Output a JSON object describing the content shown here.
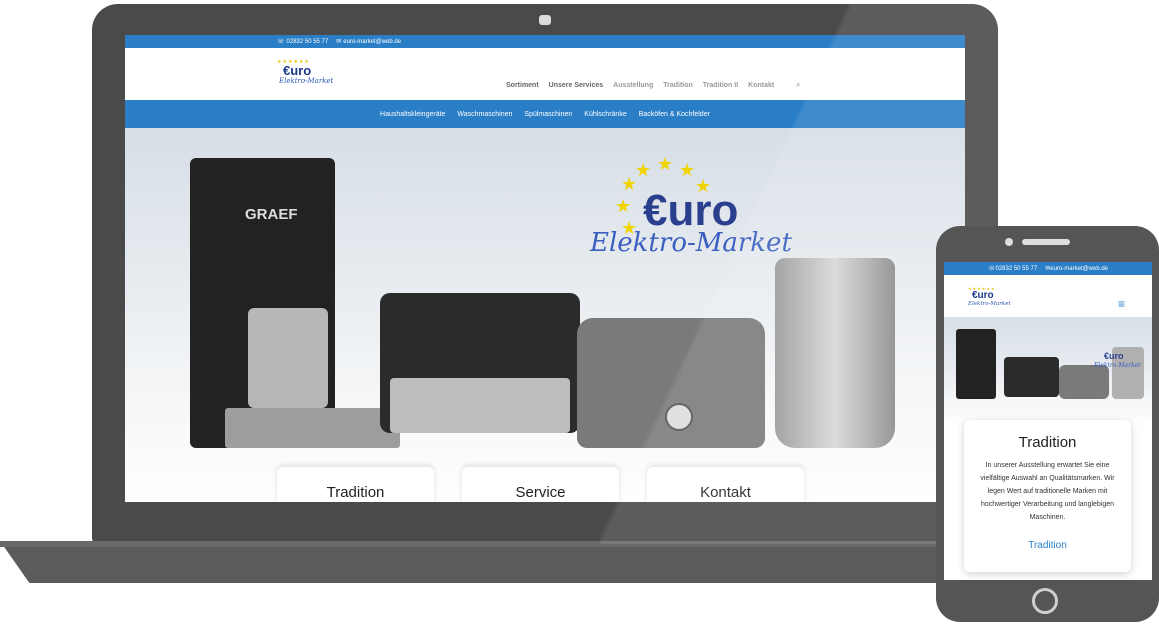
{
  "desktop": {
    "topbar": {
      "phone": "02832 50 55 77",
      "email": "euro-market@web.de"
    },
    "logo": {
      "main": "€uro",
      "sub": "Elektro-Market"
    },
    "main_nav": [
      "Sortiment",
      "Unsere Services",
      "Ausstellung",
      "Tradition",
      "Tradition II",
      "Kontakt"
    ],
    "sub_nav": [
      "Haushaltskleingeräte",
      "Waschmaschinen",
      "Spülmaschinen",
      "Kühlschränke",
      "Backöfen & Kochfelder"
    ],
    "hero": {
      "brand": "GRAEF",
      "logo_main": "€uro",
      "logo_sub": "Elektro-Market"
    },
    "cards": [
      "Tradition",
      "Service",
      "Kontakt"
    ]
  },
  "mobile": {
    "topbar": {
      "phone": "02832 50 55 77",
      "email": "euro-market@web.de"
    },
    "logo": {
      "main": "€uro",
      "sub": "Elektro-Market"
    },
    "card": {
      "title": "Tradition",
      "text": "In unserer Ausstellung erwartet Sie eine vielfältige Auswahl an Qualitätsmarken. Wir legen Wert auf traditionelle Marken mit hochwertiger Verarbeitung und langlebigen Maschinen.",
      "link": "Tradition"
    }
  },
  "colors": {
    "brand_blue": "#2a7ec6",
    "device": "#4a4a4a"
  }
}
